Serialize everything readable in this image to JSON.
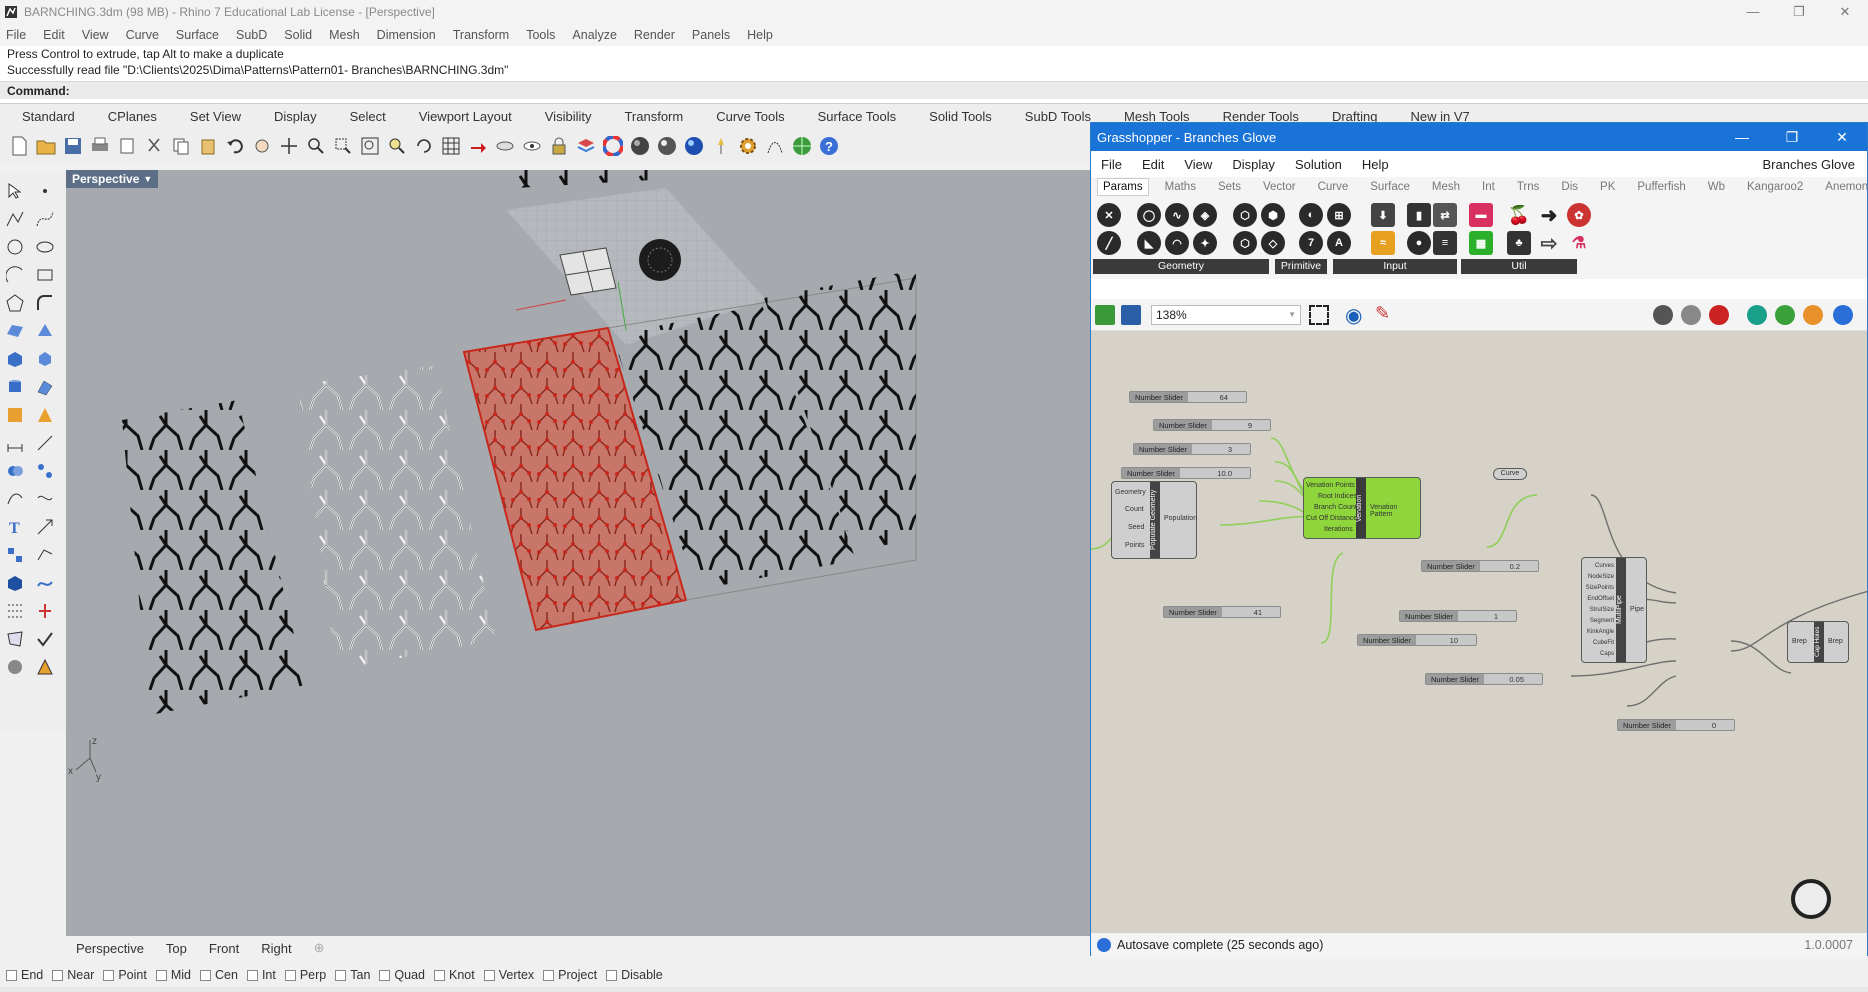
{
  "window": {
    "title": "BARNCHING.3dm (98 MB) - Rhino 7 Educational Lab License - [Perspective]",
    "controls": [
      "—",
      "❐",
      "✕"
    ]
  },
  "menu": [
    "File",
    "Edit",
    "View",
    "Curve",
    "Surface",
    "SubD",
    "Solid",
    "Mesh",
    "Dimension",
    "Transform",
    "Tools",
    "Analyze",
    "Render",
    "Panels",
    "Help"
  ],
  "command": {
    "line1": "Press Control to extrude, tap Alt to make a duplicate",
    "line2": "Successfully read file \"D:\\Clients\\2025\\Dima\\Patterns\\Pattern01- Branches\\BARNCHING.3dm\"",
    "prompt": "Command:"
  },
  "toolbar_tabs": [
    "Standard",
    "CPlanes",
    "Set View",
    "Display",
    "Select",
    "Viewport Layout",
    "Visibility",
    "Transform",
    "Curve Tools",
    "Surface Tools",
    "Solid Tools",
    "SubD Tools",
    "Mesh Tools",
    "Render Tools",
    "Drafting",
    "New in V7"
  ],
  "viewport": {
    "label": "Perspective",
    "axes": {
      "x": "x",
      "y": "y",
      "z": "z"
    }
  },
  "view_tabs": [
    "Perspective",
    "Top",
    "Front",
    "Right"
  ],
  "osnaps": [
    "End",
    "Near",
    "Point",
    "Mid",
    "Cen",
    "Int",
    "Perp",
    "Tan",
    "Quad",
    "Knot",
    "Vertex",
    "Project",
    "Disable"
  ],
  "grasshopper": {
    "title": "Grasshopper - Branches Glove",
    "controls": [
      "—",
      "❐",
      "✕"
    ],
    "menu": [
      "File",
      "Edit",
      "View",
      "Display",
      "Solution",
      "Help"
    ],
    "document": "Branches Glove",
    "tabs": [
      "Params",
      "Maths",
      "Sets",
      "Vector",
      "Curve",
      "Surface",
      "Mesh",
      "Int",
      "Trns",
      "Dis",
      "PK",
      "Pufferfish",
      "Wb",
      "Kangaroo2",
      "Anemone"
    ],
    "ribbon_groups": [
      "Geometry",
      "Primitive",
      "Input",
      "Util"
    ],
    "zoom": "138%",
    "status": "Autosave complete (25 seconds ago)",
    "version": "1.0.0007",
    "sliders": [
      {
        "label": "Number Slider",
        "value": "64"
      },
      {
        "label": "Number Slider",
        "value": "9"
      },
      {
        "label": "Number Slider",
        "value": "3"
      },
      {
        "label": "Number Slider",
        "value": "10.0"
      },
      {
        "label": "Number Slider",
        "value": "41"
      },
      {
        "label": "Number Slider",
        "value": "0.2"
      },
      {
        "label": "Number Slider",
        "value": "1"
      },
      {
        "label": "Number Slider",
        "value": "10"
      },
      {
        "label": "Number Slider",
        "value": "0.05"
      },
      {
        "label": "Number Slider",
        "value": "0"
      }
    ],
    "populate": {
      "name": "Populate Geometry",
      "inputs": [
        "Geometry",
        "Count",
        "Seed",
        "Points"
      ],
      "output": "Population"
    },
    "venation": {
      "name": "Venation",
      "inputs": [
        "Venation Points",
        "Root Indices",
        "Branch Count",
        "Cut Off Distance",
        "Iterations"
      ],
      "output": "Venation Pattern"
    },
    "curve_param": "Curve",
    "multipipe": {
      "name": "MultiPipe",
      "inputs": [
        "Curves",
        "NodeSize",
        "SizePoints",
        "EndOffset",
        "StrutSize",
        "Segment",
        "KinkAngle",
        "CubeFit",
        "Caps"
      ],
      "output": "Pipe"
    },
    "capholes": {
      "name": "Cap Holes",
      "input": "Brep",
      "output": "Brep"
    }
  }
}
